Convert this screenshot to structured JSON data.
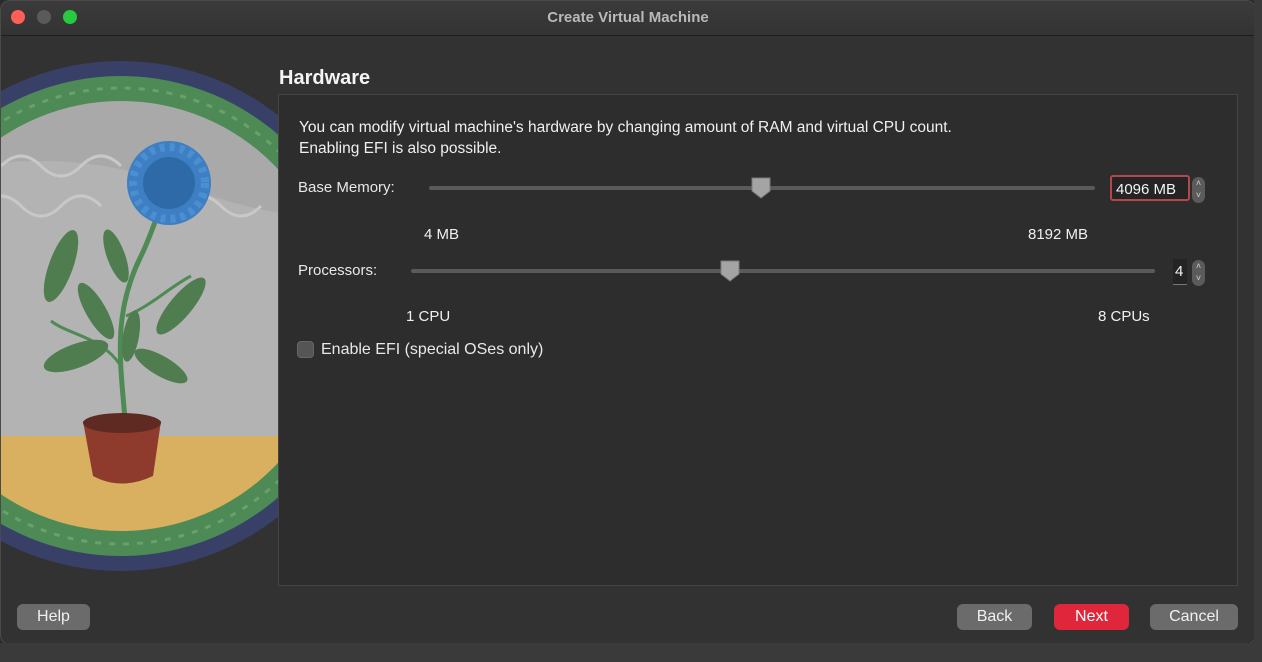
{
  "window": {
    "title": "Create Virtual Machine"
  },
  "page": {
    "heading": "Hardware",
    "description_line1": "You can modify virtual machine's hardware by changing amount of RAM and virtual CPU count.",
    "description_line2": "Enabling EFI is also possible."
  },
  "memory": {
    "label": "Base Memory:",
    "value": "4096 MB",
    "min_label": "4 MB",
    "max_label": "8192 MB",
    "slider_fraction": 0.5
  },
  "processors": {
    "label": "Processors:",
    "value": "4",
    "min_label": "1 CPU",
    "max_label": "8 CPUs",
    "slider_fraction": 0.43
  },
  "efi": {
    "label": "Enable EFI (special OSes only)",
    "checked": false
  },
  "buttons": {
    "help": "Help",
    "back": "Back",
    "next": "Next",
    "cancel": "Cancel"
  },
  "colors": {
    "accent": "#e0263b",
    "focus_ring": "#b3484c",
    "window_bg": "#323232"
  }
}
